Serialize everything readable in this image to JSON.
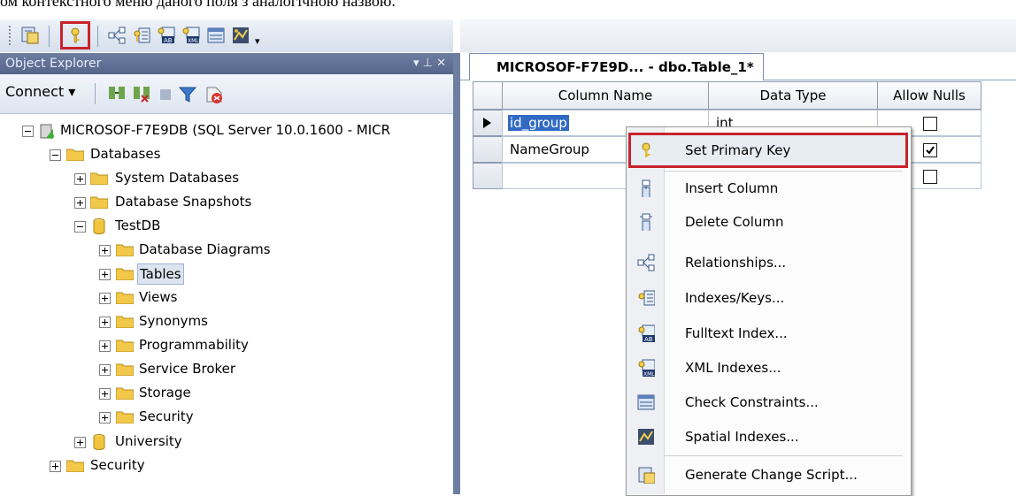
{
  "caption": "ом контекстного меню даного поля з аналогічною назвою.",
  "object_explorer": {
    "title": "Object Explorer",
    "title_controls": "▾ ⊥ ✕",
    "connect_label": "Connect ▾",
    "tree": [
      {
        "label": "MICROSOF-F7E9DB (SQL Server 10.0.1600 - MICR",
        "icon": "server-icon",
        "expander": "minus"
      },
      {
        "label": "Databases",
        "icon": "folder-icon",
        "expander": "minus"
      },
      {
        "label": "System Databases",
        "icon": "folder-icon",
        "expander": "plus"
      },
      {
        "label": "Database Snapshots",
        "icon": "folder-icon",
        "expander": "plus"
      },
      {
        "label": "TestDB",
        "icon": "database-icon",
        "expander": "minus"
      },
      {
        "label": "Database Diagrams",
        "icon": "folder-icon",
        "expander": "plus"
      },
      {
        "label": "Tables",
        "icon": "folder-icon",
        "expander": "plus",
        "selected": true
      },
      {
        "label": "Views",
        "icon": "folder-icon",
        "expander": "plus"
      },
      {
        "label": "Synonyms",
        "icon": "folder-icon",
        "expander": "plus"
      },
      {
        "label": "Programmability",
        "icon": "folder-icon",
        "expander": "plus"
      },
      {
        "label": "Service Broker",
        "icon": "folder-icon",
        "expander": "plus"
      },
      {
        "label": "Storage",
        "icon": "folder-icon",
        "expander": "plus"
      },
      {
        "label": "Security",
        "icon": "folder-icon",
        "expander": "plus"
      },
      {
        "label": "University",
        "icon": "database-icon",
        "expander": "plus"
      },
      {
        "label": "Security",
        "icon": "folder-icon",
        "expander": "plus"
      }
    ]
  },
  "designer": {
    "tab_title": "MICROSOF-F7E9D... - dbo.Table_1*",
    "columns": [
      "Column Name",
      "Data Type",
      "Allow Nulls"
    ],
    "rows": [
      {
        "name": "id_group",
        "type": "int",
        "allow_nulls": false,
        "current": true
      },
      {
        "name": "NameGroup",
        "type": "",
        "allow_nulls": true,
        "current": false
      },
      {
        "name": "",
        "type": "",
        "allow_nulls": false,
        "current": false
      }
    ]
  },
  "context_menu": {
    "items": [
      {
        "label": "Set Primary Key",
        "icon": "primary-key-icon",
        "highlighted": true
      },
      {
        "label": "Insert Column",
        "icon": "insert-column-icon"
      },
      {
        "label": "Delete Column",
        "icon": "delete-column-icon"
      },
      {
        "label": "Relationships...",
        "icon": "relationships-icon"
      },
      {
        "label": "Indexes/Keys...",
        "icon": "indexes-keys-icon"
      },
      {
        "label": "Fulltext Index...",
        "icon": "fulltext-index-icon"
      },
      {
        "label": "XML Indexes...",
        "icon": "xml-indexes-icon"
      },
      {
        "label": "Check Constraints...",
        "icon": "check-constraints-icon"
      },
      {
        "label": "Spatial Indexes...",
        "icon": "spatial-indexes-icon"
      },
      {
        "label": "Generate Change Script...",
        "icon": "generate-script-icon"
      }
    ]
  },
  "colors": {
    "accent_red": "#c8232c",
    "panel_header": "#6d7ea1",
    "folder": "#f2c84b"
  }
}
